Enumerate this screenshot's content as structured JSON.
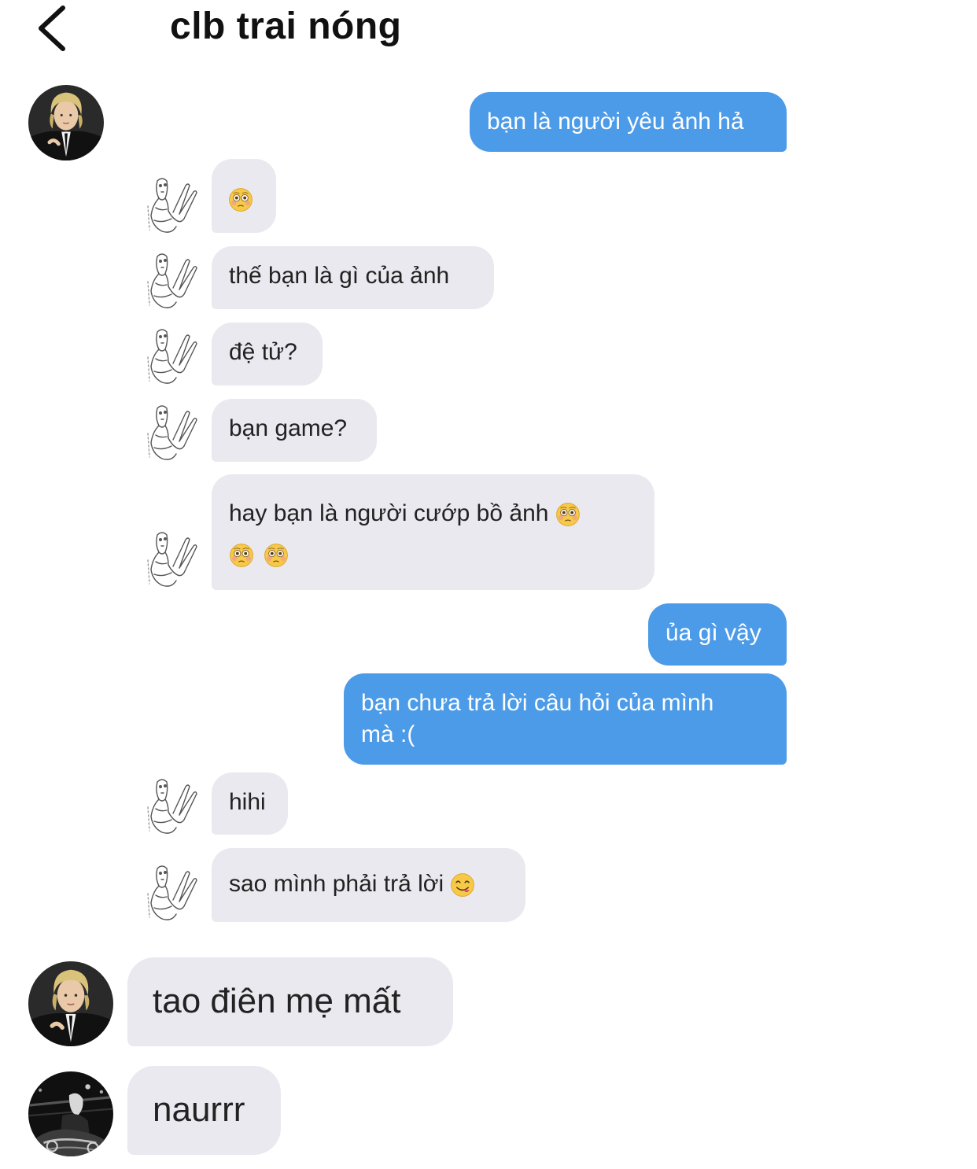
{
  "header": {
    "title": "clb trai nóng",
    "back_icon": "chevron-left-icon"
  },
  "colors": {
    "outgoing_bubble": "#4c9be8",
    "incoming_bubble": "#e9e9ef",
    "background": "#ffffff"
  },
  "messages": [
    {
      "sender": "me",
      "text": "bạn là người yêu ảnh hả"
    },
    {
      "sender": "friend",
      "text": "",
      "emoji": [
        "flushed-face-emoji"
      ]
    },
    {
      "sender": "friend",
      "text": "thế bạn là gì của ảnh"
    },
    {
      "sender": "friend",
      "text": "đệ tử?"
    },
    {
      "sender": "friend",
      "text": "bạn game?"
    },
    {
      "sender": "friend",
      "text": "hay bạn là người cướp bồ ảnh",
      "emoji": [
        "flushed-face-emoji",
        "flushed-face-emoji",
        "flushed-face-emoji"
      ]
    },
    {
      "sender": "me",
      "text": "ủa gì vậy"
    },
    {
      "sender": "me",
      "text": "bạn chưa trả lời câu hỏi của mình mà :("
    },
    {
      "sender": "friend",
      "text": "hihi"
    },
    {
      "sender": "friend",
      "text": "sao mình phải trả lời",
      "emoji": [
        "face-savoring-food-emoji"
      ]
    },
    {
      "sender": "member-blonde",
      "text": "tao điên mẹ mất"
    },
    {
      "sender": "member-dark",
      "text": "naurrr"
    }
  ],
  "message_texts": {
    "m1": "bạn là người yêu ảnh hả",
    "m3": "thế bạn là gì của ảnh",
    "m4": "đệ tử?",
    "m5": "bạn game?",
    "m6a": "hay bạn là người cướp bồ ảnh",
    "m7": "ủa gì vậy",
    "m8a": "bạn chưa trả lời câu hỏi của mình",
    "m8b": "mà :(",
    "m9": "hihi",
    "m10": "sao mình phải trả lời",
    "m11": "tao điên mẹ mất",
    "m12": "naurrr"
  }
}
